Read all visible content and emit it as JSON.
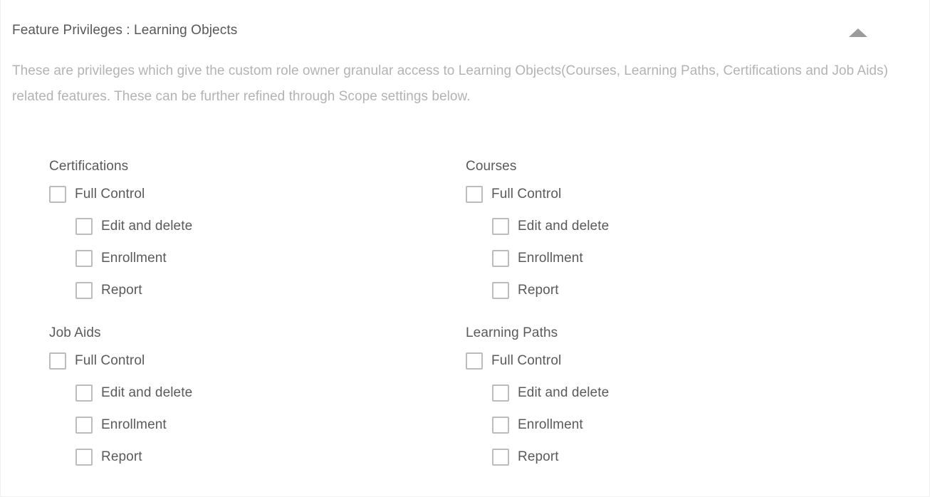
{
  "panel": {
    "title": "Feature Privileges : Learning Objects",
    "description": "These are privileges which give the custom role owner granular access to Learning Objects(Courses, Learning Paths, Certifications and Job Aids) related features. These can be further refined through Scope settings below.",
    "collapse_icon": "triangle-up-icon",
    "collapse_state": "expanded",
    "colors": {
      "title_text": "#585858",
      "description_text": "#b3b3b3",
      "label_text": "#5a5a5a",
      "checkbox_border": "#bcbcbc",
      "collapse_icon": "#9b9b9b",
      "panel_background": "#ffffff"
    }
  },
  "groups": [
    {
      "title": "Certifications",
      "privileges": [
        {
          "label": "Full Control",
          "checked": false,
          "level": "primary"
        },
        {
          "label": "Edit and delete",
          "checked": false,
          "level": "sub"
        },
        {
          "label": "Enrollment",
          "checked": false,
          "level": "sub"
        },
        {
          "label": "Report",
          "checked": false,
          "level": "sub"
        }
      ]
    },
    {
      "title": "Courses",
      "privileges": [
        {
          "label": "Full Control",
          "checked": false,
          "level": "primary"
        },
        {
          "label": "Edit and delete",
          "checked": false,
          "level": "sub"
        },
        {
          "label": "Enrollment",
          "checked": false,
          "level": "sub"
        },
        {
          "label": "Report",
          "checked": false,
          "level": "sub"
        }
      ]
    },
    {
      "title": "Job Aids",
      "privileges": [
        {
          "label": "Full Control",
          "checked": false,
          "level": "primary"
        },
        {
          "label": "Edit and delete",
          "checked": false,
          "level": "sub"
        },
        {
          "label": "Enrollment",
          "checked": false,
          "level": "sub"
        },
        {
          "label": "Report",
          "checked": false,
          "level": "sub"
        }
      ]
    },
    {
      "title": "Learning Paths",
      "privileges": [
        {
          "label": "Full Control",
          "checked": false,
          "level": "primary"
        },
        {
          "label": "Edit and delete",
          "checked": false,
          "level": "sub"
        },
        {
          "label": "Enrollment",
          "checked": false,
          "level": "sub"
        },
        {
          "label": "Report",
          "checked": false,
          "level": "sub"
        }
      ]
    }
  ]
}
